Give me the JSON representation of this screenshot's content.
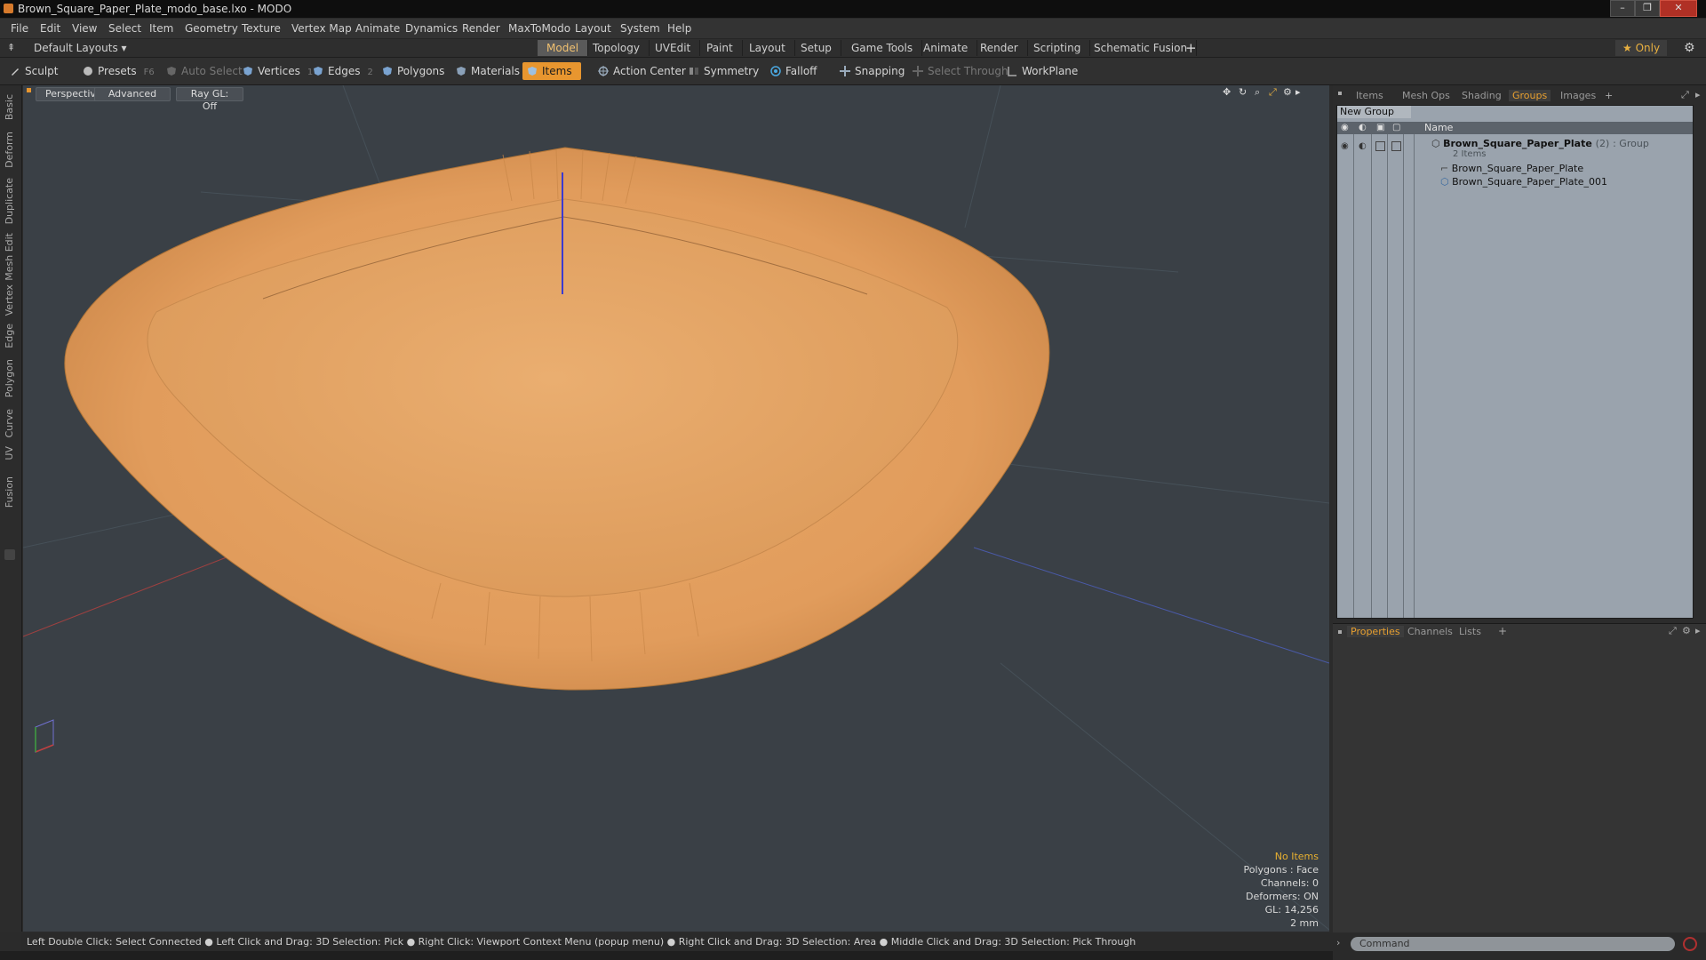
{
  "window": {
    "title": "Brown_Square_Paper_Plate_modo_base.lxo - MODO",
    "min_label": "–",
    "max_label": "❐",
    "close_label": "✕"
  },
  "menu": [
    "File",
    "Edit",
    "View",
    "Select",
    "Item",
    "Geometry",
    "Texture",
    "Vertex Map",
    "Animate",
    "Dynamics",
    "Render",
    "MaxToModo",
    "Layout",
    "System",
    "Help"
  ],
  "layouts": {
    "selector": "Default Layouts ▾",
    "tabs": [
      "Model",
      "Topology",
      "UVEdit",
      "Paint",
      "Layout",
      "Setup",
      "Game Tools",
      "Animate",
      "Render",
      "Scripting",
      "Schematic Fusion"
    ],
    "active_tab": "Model",
    "add": "+",
    "only": "★ Only",
    "gear": "⚙"
  },
  "toolbar": {
    "sculpt": "Sculpt",
    "presets": "Presets",
    "presets_key": "F6",
    "auto_select": "Auto Select",
    "vertices": "Vertices",
    "vertices_key": "1",
    "edges": "Edges",
    "edges_key": "2",
    "polygons": "Polygons",
    "materials": "Materials",
    "items": "Items",
    "action_center": "Action Center",
    "symmetry": "Symmetry",
    "falloff": "Falloff",
    "snapping": "Snapping",
    "select_through": "Select Through",
    "workplane": "WorkPlane"
  },
  "side_tabs": [
    "Basic",
    "Deform",
    "Duplicate",
    "Mesh Edit",
    "Vertex",
    "Edge",
    "Polygon",
    "Curve",
    "UV",
    "Fusion"
  ],
  "viewport": {
    "perspective": "Perspective",
    "advanced": "Advanced",
    "raygl": "Ray GL: Off",
    "info": {
      "selection": "No Items",
      "polygons": "Polygons : Face",
      "channels": "Channels: 0",
      "deformers": "Deformers: ON",
      "gl": "GL: 14,256",
      "unit": "2 mm"
    }
  },
  "right_panel": {
    "tabs": [
      "Items",
      "Mesh Ops",
      "Shading",
      "Groups",
      "Images"
    ],
    "active_tab": "Groups",
    "add": "+",
    "new_group": "New Group",
    "name_header": "Name",
    "group": {
      "name": "Brown_Square_Paper_Plate",
      "count": "(2)",
      "type": ": Group",
      "sub": "2 Items",
      "items": [
        "Brown_Square_Paper_Plate",
        "Brown_Square_Paper_Plate_001"
      ]
    },
    "bottom_tabs": [
      "Properties",
      "Channels",
      "Lists"
    ],
    "bottom_active": "Properties"
  },
  "status": {
    "hint": "Left Double Click: Select Connected ● Left Click and Drag: 3D Selection: Pick ● Right Click: Viewport Context Menu (popup menu) ● Right Click and Drag: 3D Selection: Area ● Middle Click and Drag: 3D Selection: Pick Through"
  },
  "command": {
    "placeholder": "Command"
  },
  "colors": {
    "accent": "#e8962f",
    "viewport_bg": "#3a4046",
    "plate": "#e2a160",
    "groups_bg": "#9aa3ad"
  }
}
